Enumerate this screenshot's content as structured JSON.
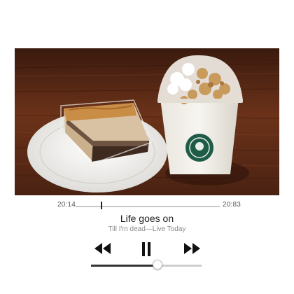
{
  "artwork": {
    "icon": "album-artwork",
    "description_colors": {
      "table": "#5a2a17",
      "plate": "#f2f1ef",
      "cup_logo": "#1e5c47"
    }
  },
  "playback": {
    "elapsed": "20:14",
    "total": "20:83",
    "progress_fraction": 0.18
  },
  "track": {
    "title": "Life goes on",
    "subtitle": "Till I'm dead—Live Today"
  },
  "controls": {
    "previous_icon": "rewind-icon",
    "play_pause_icon": "pause-icon",
    "next_icon": "fast-forward-icon"
  },
  "volume": {
    "level_fraction": 0.6
  }
}
